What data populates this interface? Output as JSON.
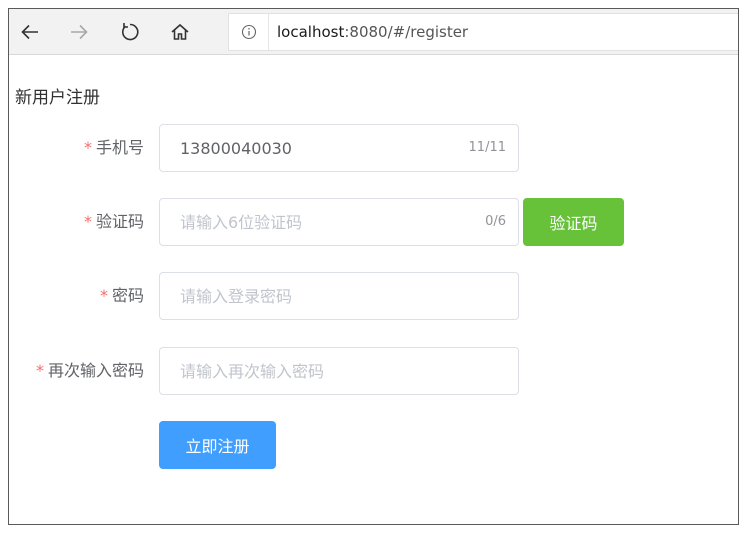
{
  "browser": {
    "url_host": "localhost",
    "url_rest": ":8080/#/register",
    "back_icon": "back-arrow-icon",
    "forward_icon": "forward-arrow-icon",
    "refresh_icon": "refresh-icon",
    "home_icon": "home-icon",
    "info_icon": "info-icon"
  },
  "page": {
    "title": "新用户注册"
  },
  "form": {
    "required_mark": "*",
    "phone": {
      "label": "手机号",
      "value": "13800040030",
      "placeholder": "",
      "counter": "11/11"
    },
    "code": {
      "label": "验证码",
      "value": "",
      "placeholder": "请输入6位验证码",
      "counter": "0/6",
      "button_label": "验证码"
    },
    "password": {
      "label": "密码",
      "value": "",
      "placeholder": "请输入登录密码"
    },
    "confirm_password": {
      "label": "再次输入密码",
      "value": "",
      "placeholder": "请输入再次输入密码"
    },
    "submit_label": "立即注册"
  },
  "colors": {
    "primary": "#409eff",
    "success": "#67c23a",
    "required": "#f56c6c"
  }
}
